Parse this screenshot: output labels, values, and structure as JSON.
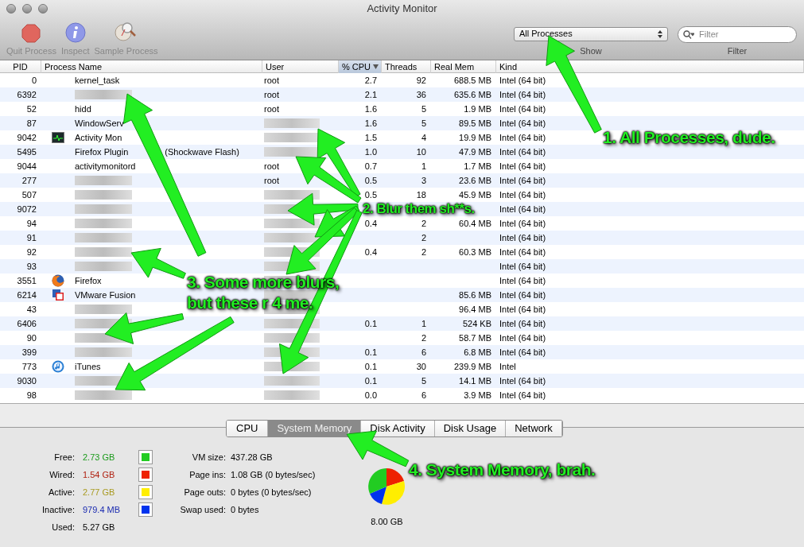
{
  "window": {
    "title": "Activity Monitor"
  },
  "toolbar": {
    "buttons": [
      {
        "label": "Quit Process",
        "kind": "quit"
      },
      {
        "label": "Inspect",
        "kind": "inspect"
      },
      {
        "label": "Sample Process",
        "kind": "sample"
      }
    ],
    "show": {
      "value": "All Processes",
      "label": "Show"
    },
    "filter": {
      "placeholder": "Filter",
      "label": "Filter"
    }
  },
  "table": {
    "columns": [
      {
        "label": "PID",
        "sorted": false
      },
      {
        "label": "Process Name",
        "sorted": false
      },
      {
        "label": "User",
        "sorted": false
      },
      {
        "label": "% CPU",
        "sorted": true
      },
      {
        "label": "Threads",
        "sorted": false
      },
      {
        "label": "Real Mem",
        "sorted": false
      },
      {
        "label": "Kind",
        "sorted": false
      }
    ],
    "rows": [
      {
        "pid": "0",
        "name": "kernel_task",
        "user": "root",
        "cpu": "2.7",
        "threads": "92",
        "mem": "688.5 MB",
        "kind": "Intel (64 bit)",
        "name_blurred": false,
        "user_blurred": false
      },
      {
        "pid": "6392",
        "user": "root",
        "cpu": "2.1",
        "threads": "36",
        "mem": "635.6 MB",
        "kind": "Intel (64 bit)",
        "name_blurred": true,
        "user_blurred": false
      },
      {
        "pid": "52",
        "name": "hidd",
        "user": "root",
        "cpu": "1.6",
        "threads": "5",
        "mem": "1.9 MB",
        "kind": "Intel (64 bit)",
        "name_blurred": false,
        "user_blurred": false
      },
      {
        "pid": "87",
        "name": "WindowServ",
        "cpu": "1.6",
        "threads": "5",
        "mem": "89.5 MB",
        "kind": "Intel (64 bit)",
        "name_blurred": false,
        "user_blurred": true
      },
      {
        "pid": "9042",
        "name": "Activity Mon",
        "cpu": "1.5",
        "threads": "4",
        "mem": "19.9 MB",
        "kind": "Intel (64 bit)",
        "name_blurred": false,
        "user_blurred": true
      },
      {
        "pid": "5495",
        "name": "Firefox Plugin",
        "name_end": "(Shockwave Flash)",
        "cpu": "1.0",
        "threads": "10",
        "mem": "47.9 MB",
        "kind": "Intel (64 bit)",
        "name_blurred": false,
        "user_blurred": true
      },
      {
        "pid": "9044",
        "name": "activitymonitord",
        "user": "root",
        "cpu": "0.7",
        "threads": "1",
        "mem": "1.7 MB",
        "kind": "Intel (64 bit)",
        "name_blurred": false,
        "user_blurred": false
      },
      {
        "pid": "277",
        "user": "root",
        "cpu": "0.5",
        "threads": "3",
        "mem": "23.6 MB",
        "kind": "Intel (64 bit)",
        "name_blurred": true,
        "user_blurred": false
      },
      {
        "pid": "507",
        "cpu": "0.5",
        "threads": "18",
        "mem": "45.9 MB",
        "kind": "Intel (64 bit)",
        "name_blurred": true,
        "user_blurred": true
      },
      {
        "pid": "9072",
        "kind": "Intel (64 bit)",
        "name_blurred": true,
        "user_blurred": true
      },
      {
        "pid": "94",
        "cpu": "0.4",
        "threads": "2",
        "mem": "60.4 MB",
        "kind": "Intel (64 bit)",
        "name_blurred": true,
        "user_blurred": true
      },
      {
        "pid": "91",
        "threads": "2",
        "kind": "Intel (64 bit)",
        "name_blurred": true,
        "user_blurred": true
      },
      {
        "pid": "92",
        "cpu": "0.4",
        "threads": "2",
        "mem": "60.3 MB",
        "kind": "Intel (64 bit)",
        "name_blurred": true,
        "user_blurred": true
      },
      {
        "pid": "93",
        "kind": "Intel (64 bit)",
        "name_blurred": true,
        "user_blurred": true
      },
      {
        "pid": "3551",
        "name": "Firefox",
        "kind": "Intel (64 bit)",
        "name_blurred": false,
        "user_blurred": true
      },
      {
        "pid": "6214",
        "name": "VMware Fusion",
        "mem": "85.6 MB",
        "kind": "Intel (64 bit)",
        "name_blurred": false,
        "user_blurred": true
      },
      {
        "pid": "43",
        "mem": "96.4 MB",
        "kind": "Intel (64 bit)",
        "name_blurred": true,
        "user_blurred": true
      },
      {
        "pid": "6406",
        "cpu": "0.1",
        "threads": "1",
        "mem": "524 KB",
        "kind": "Intel (64 bit)",
        "name_blurred": true,
        "user_blurred": true
      },
      {
        "pid": "90",
        "threads": "2",
        "mem": "58.7 MB",
        "kind": "Intel (64 bit)",
        "name_blurred": true,
        "user_blurred": true
      },
      {
        "pid": "399",
        "cpu": "0.1",
        "threads": "6",
        "mem": "6.8 MB",
        "kind": "Intel (64 bit)",
        "name_blurred": true,
        "user_blurred": true
      },
      {
        "pid": "773",
        "name": "iTunes",
        "cpu": "0.1",
        "threads": "30",
        "mem": "239.9 MB",
        "kind": "Intel",
        "name_blurred": false,
        "user_blurred": true
      },
      {
        "pid": "9030",
        "cpu": "0.1",
        "threads": "5",
        "mem": "14.1 MB",
        "kind": "Intel (64 bit)",
        "name_blurred": true,
        "user_blurred": true
      },
      {
        "pid": "98",
        "cpu": "0.0",
        "threads": "6",
        "mem": "3.9 MB",
        "kind": "Intel (64 bit)",
        "name_blurred": true,
        "user_blurred": true
      }
    ]
  },
  "tabs": [
    {
      "label": "CPU",
      "selected": false
    },
    {
      "label": "System Memory",
      "selected": true
    },
    {
      "label": "Disk Activity",
      "selected": false
    },
    {
      "label": "Disk Usage",
      "selected": false
    },
    {
      "label": "Network",
      "selected": false
    }
  ],
  "memory": [
    {
      "label": "Free:",
      "value": "2.73 GB",
      "color": "#22cc22"
    },
    {
      "label": "Wired:",
      "value": "1.54 GB",
      "color": "#ee2200"
    },
    {
      "label": "Active:",
      "value": "2.77 GB",
      "color": "#ffee00"
    },
    {
      "label": "Inactive:",
      "value": "979.4 MB",
      "color": "#0033ee"
    },
    {
      "label": "Used:",
      "value": "5.27 GB"
    }
  ],
  "vm": [
    {
      "label": "VM size:",
      "value": "437.28 GB"
    },
    {
      "label": "Page ins:",
      "value": "1.08 GB (0 bytes/sec)"
    },
    {
      "label": "Page outs:",
      "value": "0 bytes (0 bytes/sec)"
    },
    {
      "label": "Swap used:",
      "value": "0 bytes"
    }
  ],
  "total": "8.00 GB",
  "annotations": [
    "1. All Processes, dude.",
    "2. Blur them sh**s.",
    "3. Some more blurs,\nbut these r 4 me.",
    "4. System Memory, brah."
  ]
}
